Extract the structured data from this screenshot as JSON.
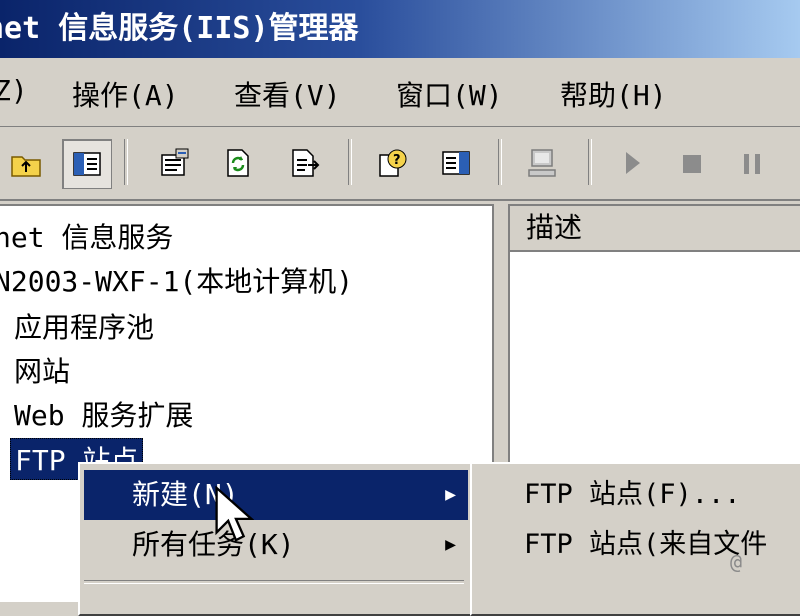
{
  "window": {
    "title": "net 信息服务(IIS)管理器"
  },
  "menubar": {
    "items": [
      {
        "label": "Z)"
      },
      {
        "label": "操作(A)"
      },
      {
        "label": "查看(V)"
      },
      {
        "label": "窗口(W)"
      },
      {
        "label": "帮助(H)"
      }
    ]
  },
  "toolbar": {
    "buttons": [
      {
        "icon": "folder-up-icon"
      },
      {
        "icon": "show-hide-tree-icon"
      },
      {
        "icon": "properties-icon"
      },
      {
        "icon": "refresh-icon"
      },
      {
        "icon": "export-list-icon"
      },
      {
        "icon": "help-icon"
      },
      {
        "icon": "show-hide-action-pane-icon"
      },
      {
        "icon": "computer-icon"
      },
      {
        "icon": "start-icon"
      },
      {
        "icon": "stop-icon"
      },
      {
        "icon": "pause-icon"
      }
    ]
  },
  "tree": {
    "nodes": [
      {
        "label": "net 信息服务"
      },
      {
        "label": "N2003-WXF-1(本地计算机)"
      },
      {
        "label": "应用程序池"
      },
      {
        "label": "网站"
      },
      {
        "label": "Web 服务扩展"
      },
      {
        "label": "FTP 站点"
      }
    ],
    "selected": "FTP 站点"
  },
  "listview": {
    "columns": [
      {
        "label": "描述"
      }
    ]
  },
  "context_menu": {
    "items": [
      {
        "label": "新建(N)",
        "has_submenu": true,
        "highlighted": true
      },
      {
        "label": "所有任务(K)",
        "has_submenu": true,
        "highlighted": false
      }
    ]
  },
  "submenu": {
    "items": [
      {
        "label": "FTP 站点(F)..."
      },
      {
        "label": "FTP 站点(来自文件"
      }
    ]
  },
  "watermark": {
    "text": "@"
  },
  "colors": {
    "title_start": "#0a246a",
    "title_end": "#a6caf0",
    "highlight": "#0a246a",
    "face": "#d4d0c8"
  }
}
